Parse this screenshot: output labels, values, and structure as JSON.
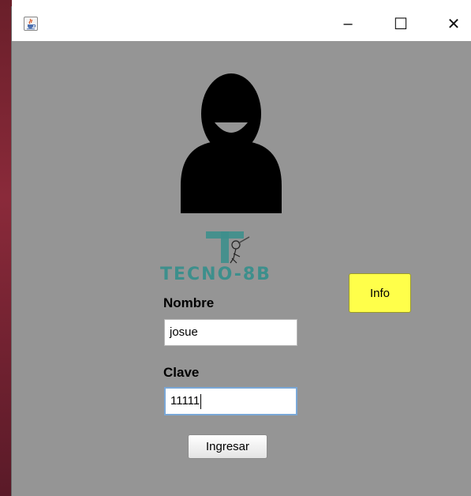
{
  "window": {
    "title": "",
    "app_icon": "java-cup-icon",
    "controls": {
      "minimize": "–",
      "maximize": "☐",
      "close": "✕"
    }
  },
  "logo": {
    "icon": "tecno-8b-logo",
    "text": "TECNO-8B",
    "color": "#3d8f8c"
  },
  "avatar": {
    "icon": "user-avatar-icon"
  },
  "form": {
    "nombre_label": "Nombre",
    "nombre_value": "josue",
    "clave_label": "Clave",
    "clave_value": "11111",
    "submit_label": "Ingresar"
  },
  "info_button": {
    "label": "Info",
    "color": "#ffff4a"
  },
  "colors": {
    "panel_background": "#959595",
    "focus_border": "#7aa7d6"
  }
}
